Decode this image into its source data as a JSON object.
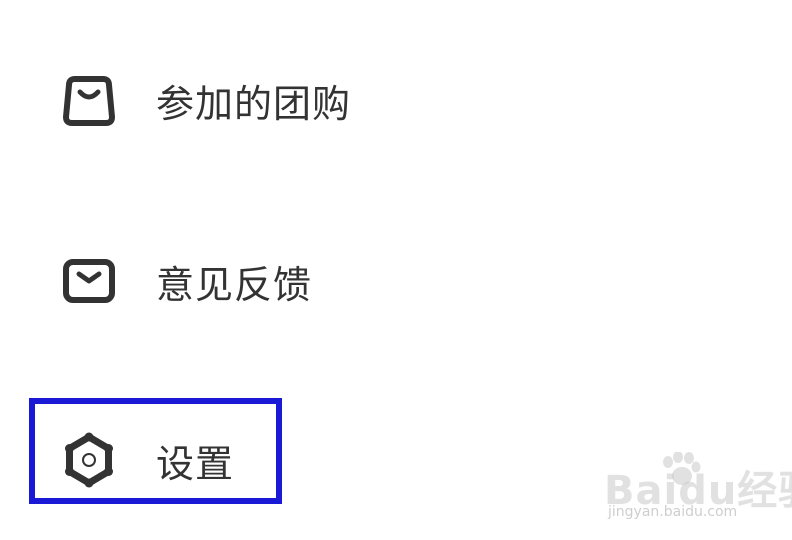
{
  "menu": {
    "items": [
      {
        "id": "group-buy",
        "label": "参加的团购",
        "icon": "shopping-bag-icon"
      },
      {
        "id": "feedback",
        "label": "意见反馈",
        "icon": "envelope-icon"
      },
      {
        "id": "settings",
        "label": "设置",
        "icon": "gear-icon"
      }
    ]
  },
  "highlight": {
    "target": "settings",
    "color": "#1a1ad6"
  },
  "watermark": {
    "logo": "Baidu经验",
    "url": "jingyan.baidu.com"
  },
  "colors": {
    "icon": "#333333",
    "text": "#333333",
    "background": "#ffffff"
  }
}
